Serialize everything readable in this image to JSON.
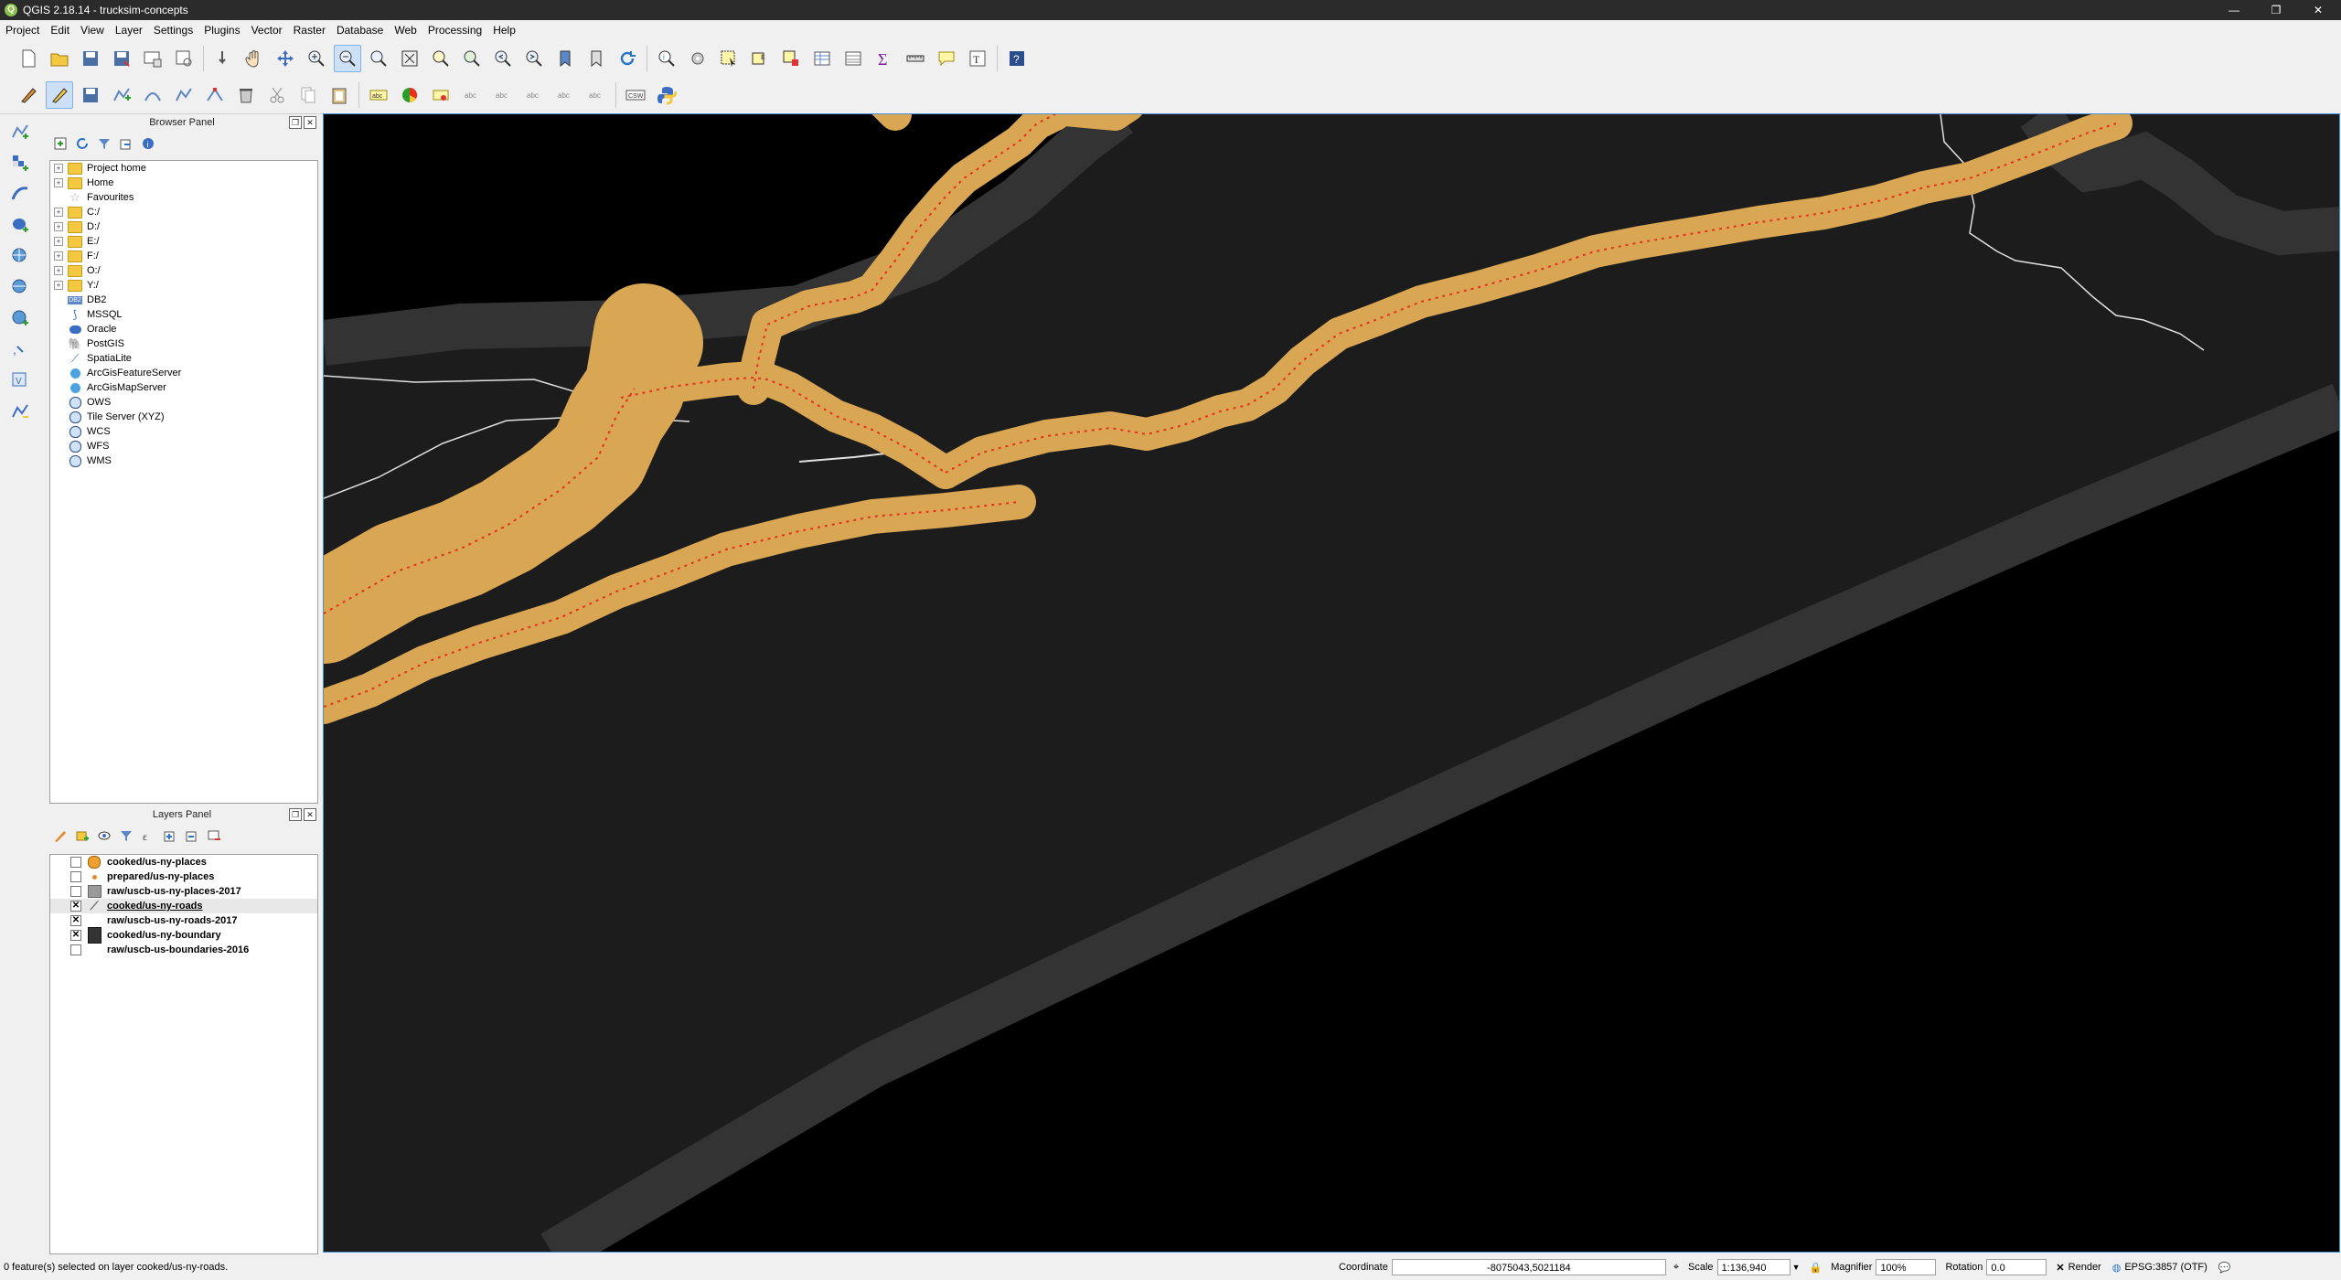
{
  "window": {
    "title": "QGIS 2.18.14 - trucksim-concepts",
    "app_icon": "qgis-logo-icon"
  },
  "menu": [
    "Project",
    "Edit",
    "View",
    "Layer",
    "Settings",
    "Plugins",
    "Vector",
    "Raster",
    "Database",
    "Web",
    "Processing",
    "Help"
  ],
  "browser_panel": {
    "title": "Browser Panel",
    "items": [
      {
        "label": "Project home",
        "icon": "folder-icon",
        "expandable": true
      },
      {
        "label": "Home",
        "icon": "folder-icon",
        "expandable": true
      },
      {
        "label": "Favourites",
        "icon": "star-icon",
        "expandable": false
      },
      {
        "label": "C:/",
        "icon": "folder-icon",
        "expandable": true
      },
      {
        "label": "D:/",
        "icon": "folder-icon",
        "expandable": true
      },
      {
        "label": "E:/",
        "icon": "folder-icon",
        "expandable": true
      },
      {
        "label": "F:/",
        "icon": "folder-icon",
        "expandable": true
      },
      {
        "label": "O:/",
        "icon": "folder-icon",
        "expandable": true
      },
      {
        "label": "Y:/",
        "icon": "folder-icon",
        "expandable": true
      },
      {
        "label": "DB2",
        "icon": "db2-icon",
        "expandable": false
      },
      {
        "label": "MSSQL",
        "icon": "mssql-icon",
        "expandable": false
      },
      {
        "label": "Oracle",
        "icon": "oracle-icon",
        "expandable": false
      },
      {
        "label": "PostGIS",
        "icon": "postgis-icon",
        "expandable": false
      },
      {
        "label": "SpatiaLite",
        "icon": "spatialite-icon",
        "expandable": false
      },
      {
        "label": "ArcGisFeatureServer",
        "icon": "arcgis-icon",
        "expandable": false
      },
      {
        "label": "ArcGisMapServer",
        "icon": "arcgis-icon",
        "expandable": false
      },
      {
        "label": "OWS",
        "icon": "globe-icon",
        "expandable": false
      },
      {
        "label": "Tile Server (XYZ)",
        "icon": "globe-icon",
        "expandable": false
      },
      {
        "label": "WCS",
        "icon": "globe-icon",
        "expandable": false
      },
      {
        "label": "WFS",
        "icon": "globe-icon",
        "expandable": false
      },
      {
        "label": "WMS",
        "icon": "globe-icon",
        "expandable": false
      }
    ]
  },
  "layers_panel": {
    "title": "Layers Panel",
    "layers": [
      {
        "name": "cooked/us-ny-places",
        "checked": false,
        "symbol": "circle-orange"
      },
      {
        "name": "prepared/us-ny-places",
        "checked": false,
        "symbol": "dot"
      },
      {
        "name": "raw/uscb-us-ny-places-2017",
        "checked": false,
        "symbol": "square-gray"
      },
      {
        "name": "cooked/us-ny-roads",
        "checked": true,
        "symbol": "line-icon",
        "selected": true
      },
      {
        "name": "raw/uscb-us-ny-roads-2017",
        "checked": true,
        "symbol": "none"
      },
      {
        "name": "cooked/us-ny-boundary",
        "checked": true,
        "symbol": "square-dark"
      },
      {
        "name": "raw/uscb-us-boundaries-2016",
        "checked": false,
        "symbol": "none"
      }
    ]
  },
  "map": {
    "background": "#000000",
    "land_color": "#1c1c1c",
    "boundary_band_color": "#333333",
    "road_buffer_color": "#d9a653",
    "road_vertex_color": "#e8301c",
    "raw_road_color": "#e0e0e0"
  },
  "status": {
    "message": "0 feature(s) selected on layer cooked/us-ny-roads.",
    "coordinate_label": "Coordinate",
    "coordinate": "-8075043,5021184",
    "scale_label": "Scale",
    "scale": "1:136,940",
    "magnifier_label": "Magnifier",
    "magnifier": "100%",
    "rotation_label": "Rotation",
    "rotation": "0.0",
    "render_label": "Render",
    "crs": "EPSG:3857 (OTF)"
  }
}
